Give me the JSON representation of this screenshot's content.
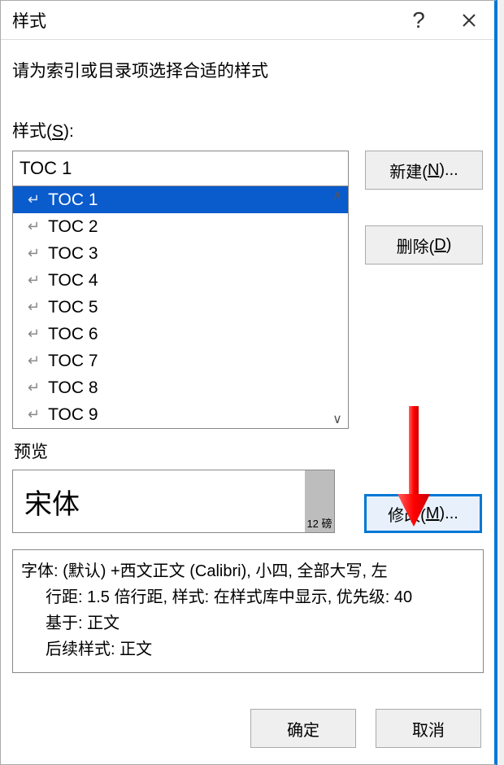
{
  "titlebar": {
    "title": "样式"
  },
  "instruction": "请为索引或目录项选择合适的样式",
  "labels": {
    "styles_prefix": "样式(",
    "styles_key": "S",
    "styles_suffix": "):",
    "preview": "预览"
  },
  "styleInput": "TOC 1",
  "styleList": [
    {
      "name": "TOC 1",
      "selected": true
    },
    {
      "name": "TOC 2",
      "selected": false
    },
    {
      "name": "TOC 3",
      "selected": false
    },
    {
      "name": "TOC 4",
      "selected": false
    },
    {
      "name": "TOC 5",
      "selected": false
    },
    {
      "name": "TOC 6",
      "selected": false
    },
    {
      "name": "TOC 7",
      "selected": false
    },
    {
      "name": "TOC 8",
      "selected": false
    },
    {
      "name": "TOC 9",
      "selected": false
    }
  ],
  "buttons": {
    "new_prefix": "新建(",
    "new_key": "N",
    "new_suffix": ")...",
    "delete_prefix": "删除(",
    "delete_key": "D",
    "delete_suffix": ")",
    "modify_prefix": "修改(",
    "modify_key": "M",
    "modify_suffix": ")...",
    "ok": "确定",
    "cancel": "取消"
  },
  "preview": {
    "fontName": "宋体",
    "size": "12 磅"
  },
  "description": {
    "line1": "字体: (默认) +西文正文 (Calibri), 小四, 全部大写, 左",
    "line2": "行距: 1.5 倍行距, 样式: 在样式库中显示, 优先级: 40",
    "line3": "基于: 正文",
    "line4": "后续样式: 正文"
  }
}
